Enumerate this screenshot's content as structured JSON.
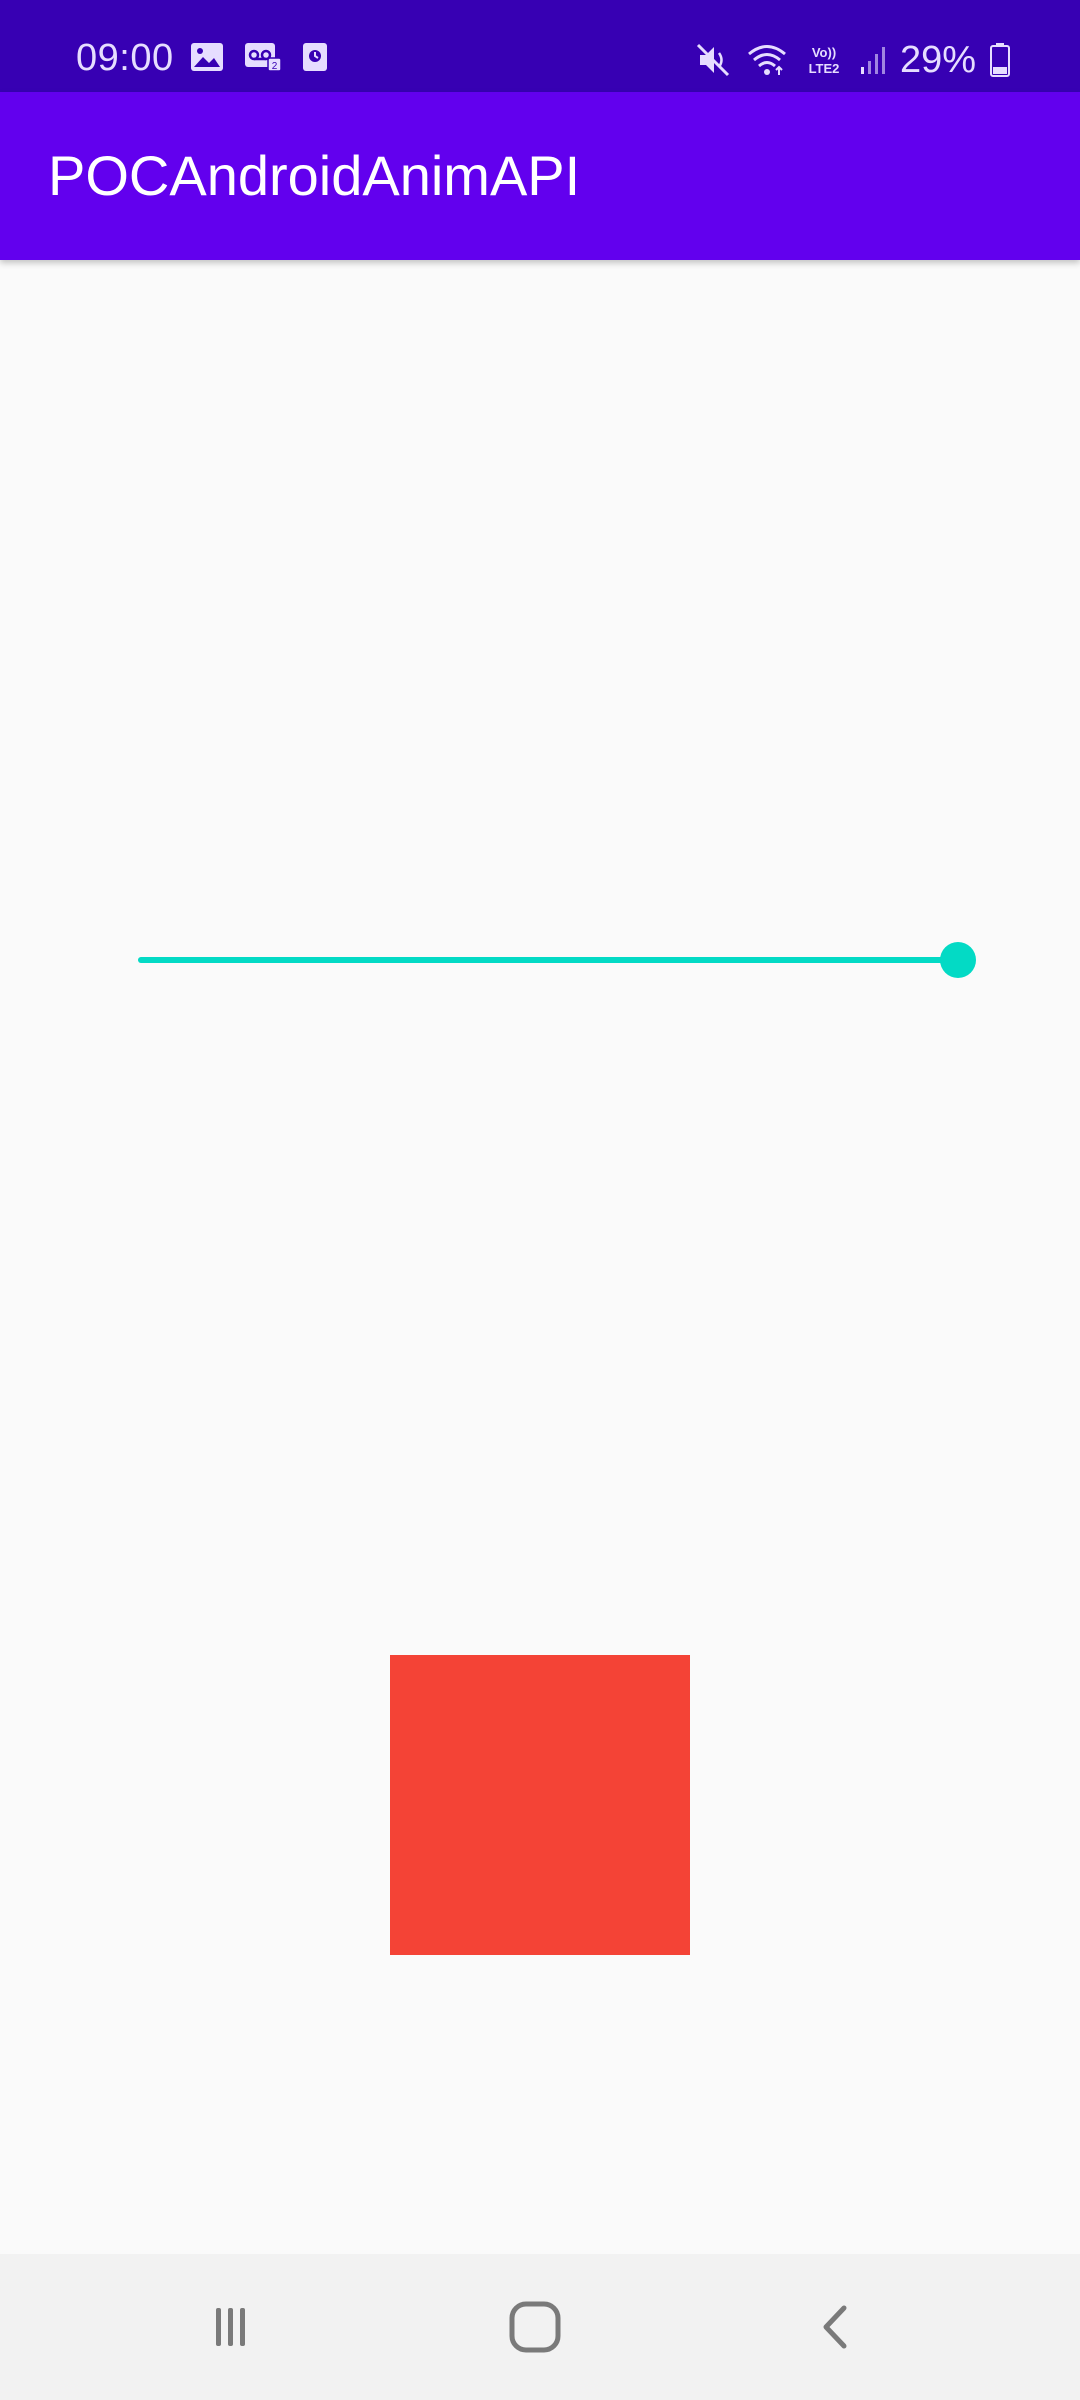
{
  "status_bar": {
    "time": "09:00",
    "battery_percent": "29%",
    "network_label": "Vo)) LTE2",
    "icons": [
      "image-icon",
      "voicemail-icon",
      "app-notification-icon",
      "mute-icon",
      "wifi-icon",
      "signal-icon",
      "battery-icon"
    ]
  },
  "app_bar": {
    "title": "POCAndroidAnimAPI"
  },
  "slider": {
    "value": 1.0,
    "accent_color": "#03DAC5"
  },
  "animated_view": {
    "color": "#F44336"
  },
  "nav_bar": {
    "buttons": [
      "recents-icon",
      "home-icon",
      "back-icon"
    ]
  },
  "colors": {
    "primary": "#6200EE",
    "primary_dark": "#3700B3",
    "background": "#FAFAFA"
  }
}
